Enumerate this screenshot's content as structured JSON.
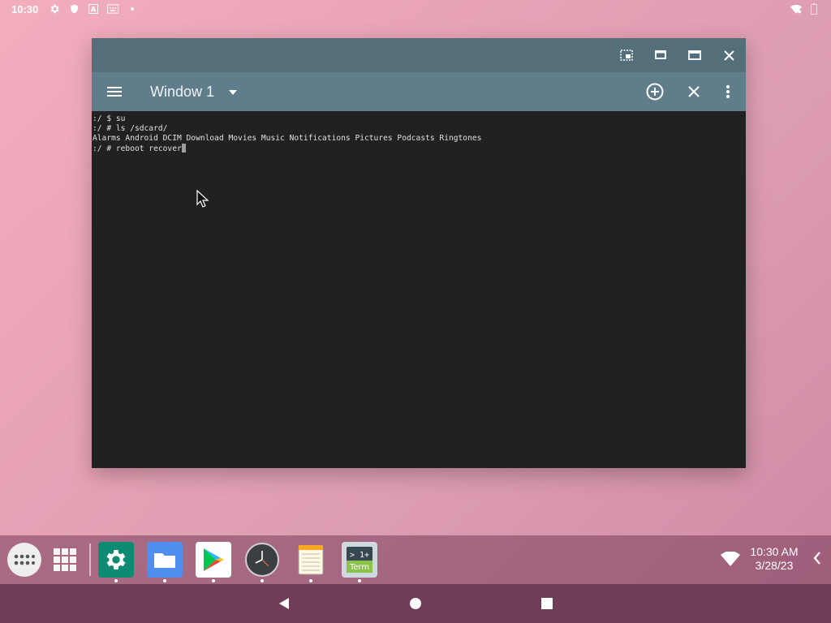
{
  "status_bar": {
    "time": "10:30",
    "icons": [
      "gear-icon",
      "shield-icon",
      "font-a-icon",
      "keyboard-icon",
      "dot-icon"
    ],
    "right_icons": [
      "wifi-icon",
      "battery-icon"
    ]
  },
  "window": {
    "caption_buttons": [
      "picture-in-picture-icon",
      "restore-icon",
      "maximize-icon",
      "close-icon"
    ],
    "toolbar": {
      "window_label": "Window 1",
      "actions": [
        "add-window-icon",
        "close-window-icon",
        "more-vert-icon"
      ]
    },
    "terminal": {
      "lines": [
        ":/ $ su",
        ":/ # ls /sdcard/",
        "Alarms Android DCIM Download Movies Music Notifications Pictures Podcasts Ringtones",
        ":/ # reboot recover"
      ]
    }
  },
  "taskbar": {
    "apps": [
      {
        "name": "settings",
        "icon": "settings-app-icon"
      },
      {
        "name": "files",
        "icon": "files-app-icon"
      },
      {
        "name": "play-store",
        "icon": "play-store-icon"
      },
      {
        "name": "clock",
        "icon": "clock-app-icon"
      },
      {
        "name": "notes",
        "icon": "notes-app-icon"
      },
      {
        "name": "terminal",
        "icon": "terminal-app-icon",
        "label": "> 1+\nTerm"
      }
    ],
    "clock_time": "10:30 AM",
    "clock_date": "3/28/23"
  },
  "colors": {
    "caption": "#546e7a",
    "toolbar": "#607d8b",
    "terminal_bg": "#212121",
    "navbar": "#6f3d57"
  }
}
